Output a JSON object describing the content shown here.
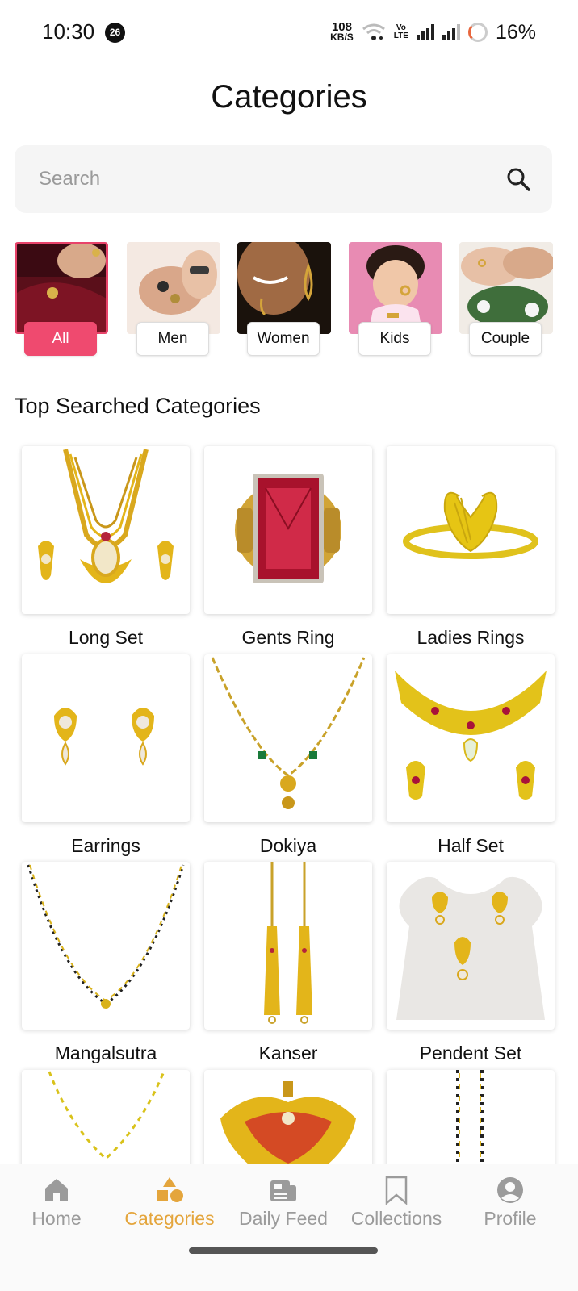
{
  "status_bar": {
    "time": "10:30",
    "notification_count": "26",
    "net_speed_value": "108",
    "net_speed_unit": "KB/S",
    "volte_line1": "Vo",
    "volte_line2": "LTE",
    "battery": "16%"
  },
  "header": {
    "title": "Categories"
  },
  "search": {
    "placeholder": "Search",
    "icon": "search-icon"
  },
  "filters": [
    {
      "label": "All",
      "active": true
    },
    {
      "label": "Men",
      "active": false
    },
    {
      "label": "Women",
      "active": false
    },
    {
      "label": "Kids",
      "active": false
    },
    {
      "label": "Couple",
      "active": false
    }
  ],
  "section_title": "Top Searched Categories",
  "categories": [
    {
      "label": "Long Set"
    },
    {
      "label": "Gents Ring"
    },
    {
      "label": "Ladies Rings"
    },
    {
      "label": "Earrings"
    },
    {
      "label": "Dokiya"
    },
    {
      "label": "Half Set"
    },
    {
      "label": "Mangalsutra"
    },
    {
      "label": "Kanser"
    },
    {
      "label": "Pendent Set"
    },
    {
      "label": ""
    },
    {
      "label": ""
    },
    {
      "label": ""
    }
  ],
  "bottom_nav": [
    {
      "label": "Home",
      "icon": "home-icon",
      "active": false
    },
    {
      "label": "Categories",
      "icon": "categories-icon",
      "active": true
    },
    {
      "label": "Daily Feed",
      "icon": "daily-feed-icon",
      "active": false
    },
    {
      "label": "Collections",
      "icon": "bookmark-icon",
      "active": false
    },
    {
      "label": "Profile",
      "icon": "profile-icon",
      "active": false
    }
  ],
  "colors": {
    "accent_pink": "#ef4a6f",
    "active_nav": "#e4a53c",
    "inactive_nav": "#9b9b9b",
    "gold": "#e3b51a"
  }
}
